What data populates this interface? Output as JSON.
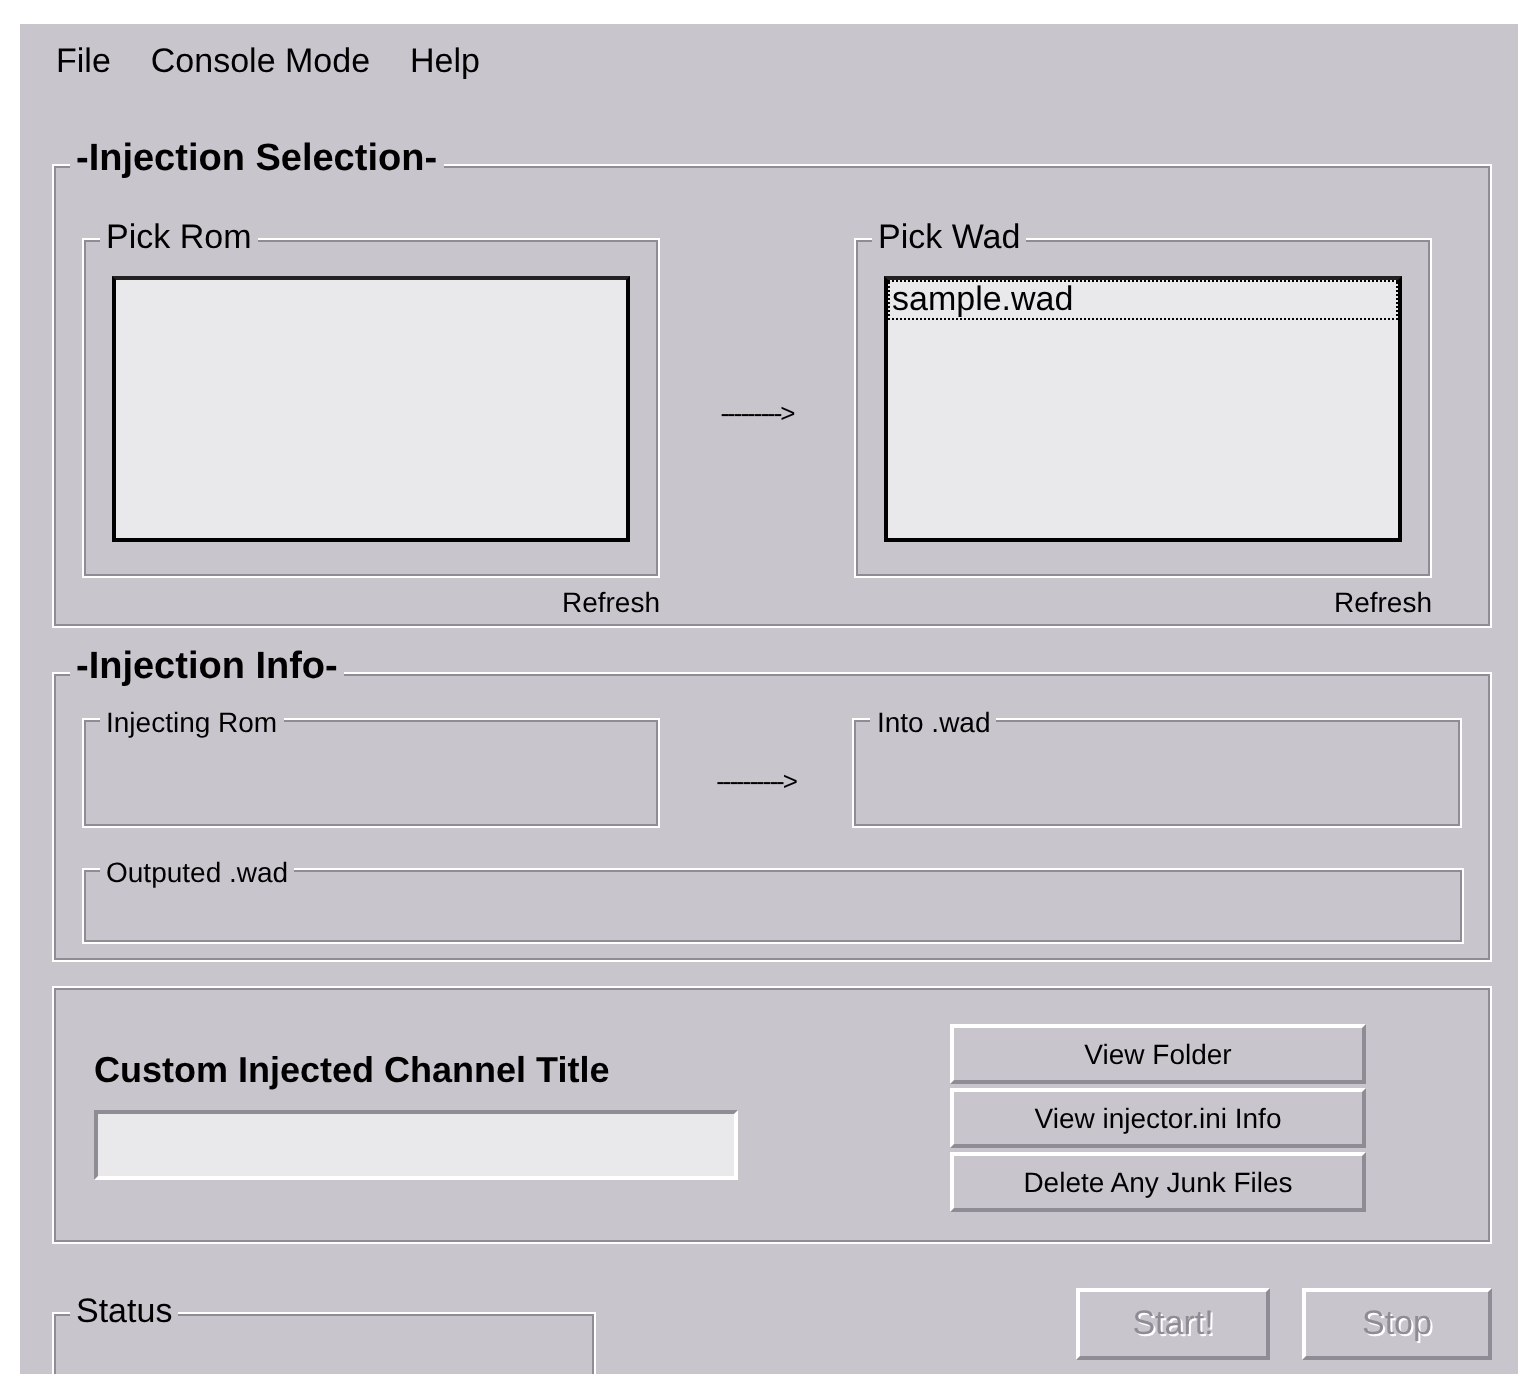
{
  "menu": [
    {
      "label": "File"
    },
    {
      "label": "Console Mode"
    },
    {
      "label": "Help"
    }
  ],
  "injection_selection": {
    "title": "-Injection Selection-",
    "pick_rom": {
      "label": "Pick Rom",
      "refresh": "Refresh"
    },
    "arrow": "--------->",
    "pick_wad": {
      "label": "Pick Wad",
      "items": [
        {
          "label": "sample.wad",
          "selected": true
        }
      ],
      "refresh": "Refresh"
    }
  },
  "injection_info": {
    "title": "-Injection Info-",
    "injecting_rom": "Injecting Rom",
    "arrow": "---------->",
    "into_wad": "Into .wad",
    "outputed_wad": "Outputed .wad"
  },
  "custom_title": {
    "label": "Custom Injected Channel Title"
  },
  "buttons": [
    {
      "label": "View Folder"
    },
    {
      "label": "View injector.ini Info"
    },
    {
      "label": "Delete Any Junk Files"
    }
  ],
  "status": {
    "label": "Status"
  },
  "actions": [
    {
      "label": "Start!",
      "disabled": true
    },
    {
      "label": "Stop",
      "disabled": true
    }
  ]
}
